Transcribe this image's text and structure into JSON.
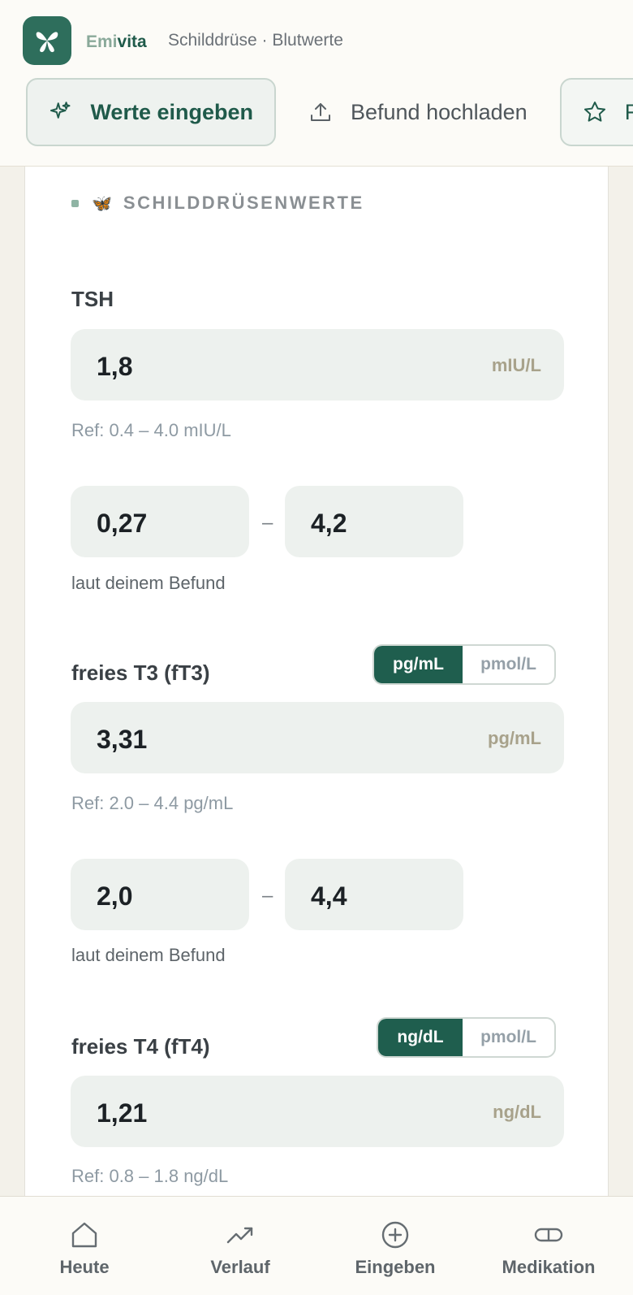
{
  "app": {
    "brand_part1": "Emi",
    "brand_part2": "vita",
    "subtitle": "Schilddrüse · Blutwerte",
    "logo_icon": "butterfly-icon",
    "accent_color": "#1f5e4e"
  },
  "tabs": [
    {
      "label": "Werte eingeben",
      "icon": "sparkle-icon",
      "active": true
    },
    {
      "label": "Befund hochladen",
      "icon": "upload-icon",
      "active": false
    },
    {
      "label": "F",
      "icon": "star-icon",
      "active": false
    }
  ],
  "section": {
    "emoji": "🦋",
    "title": "SCHILDDRÜSENWERTE"
  },
  "tsh": {
    "label": "TSH",
    "value": "1,8",
    "unit": "mIU/L",
    "ref": "Ref: 0.4 – 4.0 mIU/L",
    "range_low": "0,27",
    "range_high": "4,2",
    "range_note": "laut deinem Befund"
  },
  "ft3": {
    "label": "freies T3 (fT3)",
    "unit_options": [
      "pg/mL",
      "pmol/L"
    ],
    "selected_unit": "pg/mL",
    "value": "3,31",
    "unit": "pg/mL",
    "ref": "Ref: 2.0 – 4.4 pg/mL",
    "range_low": "2,0",
    "range_high": "4,4",
    "range_note": "laut deinem Befund"
  },
  "ft4": {
    "label": "freies T4 (fT4)",
    "unit_options": [
      "ng/dL",
      "pmol/L"
    ],
    "selected_unit": "ng/dL",
    "value": "1,21",
    "unit": "ng/dL",
    "ref": "Ref: 0.8 – 1.8 ng/dL"
  },
  "dash": "–",
  "bottom_nav": [
    {
      "label": "Heute",
      "icon": "home-icon"
    },
    {
      "label": "Verlauf",
      "icon": "trend-icon"
    },
    {
      "label": "Eingeben",
      "icon": "plus-circle-icon"
    },
    {
      "label": "Medikation",
      "icon": "pill-icon"
    }
  ]
}
